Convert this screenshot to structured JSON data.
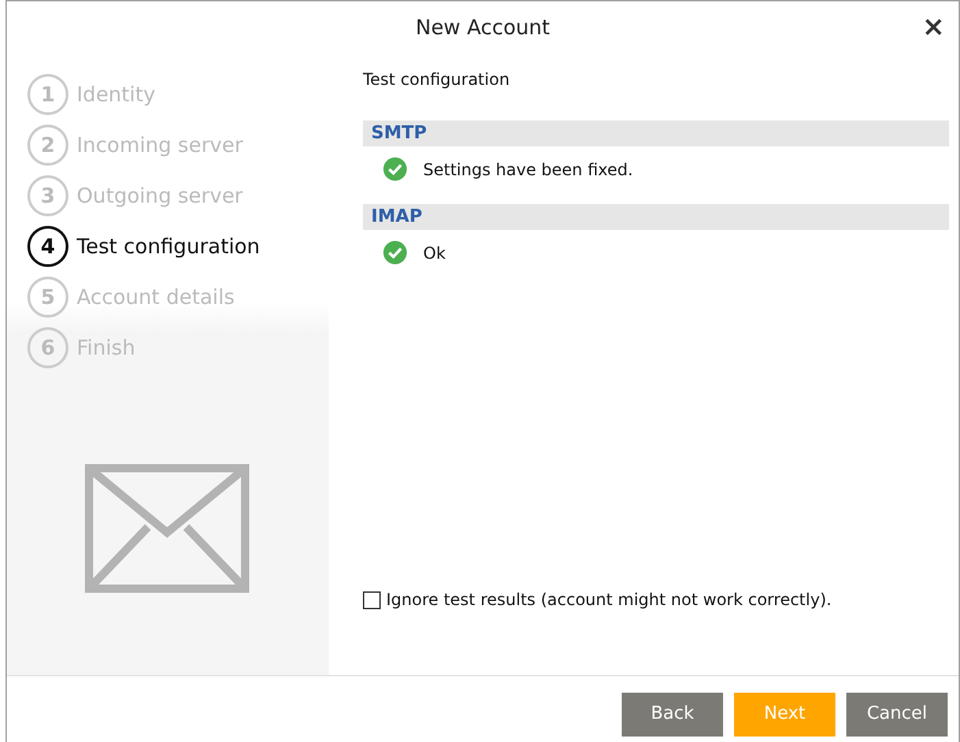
{
  "window": {
    "title": "New Account",
    "close": "×"
  },
  "steps": [
    {
      "number": "1",
      "label": "Identity",
      "selected": false
    },
    {
      "number": "2",
      "label": "Incoming server",
      "selected": false
    },
    {
      "number": "3",
      "label": "Outgoing server",
      "selected": false
    },
    {
      "number": "4",
      "label": "Test configuration",
      "selected": true
    },
    {
      "number": "5",
      "label": "Account details",
      "selected": false
    },
    {
      "number": "6",
      "label": "Finish",
      "selected": false
    }
  ],
  "page_title": "Test configuration",
  "sections": [
    {
      "name": "SMTP",
      "kind": "ok",
      "message": "Settings have been fixed."
    },
    {
      "name": "IMAP",
      "kind": "ok",
      "message": "Ok"
    }
  ],
  "ignore_checkbox": {
    "label": "Ignore test results (account might not work correctly).",
    "checked": false
  },
  "buttons": [
    {
      "label": "Back",
      "kind": "default"
    },
    {
      "label": "Next",
      "kind": "primary"
    },
    {
      "label": "Cancel",
      "kind": "default"
    }
  ]
}
